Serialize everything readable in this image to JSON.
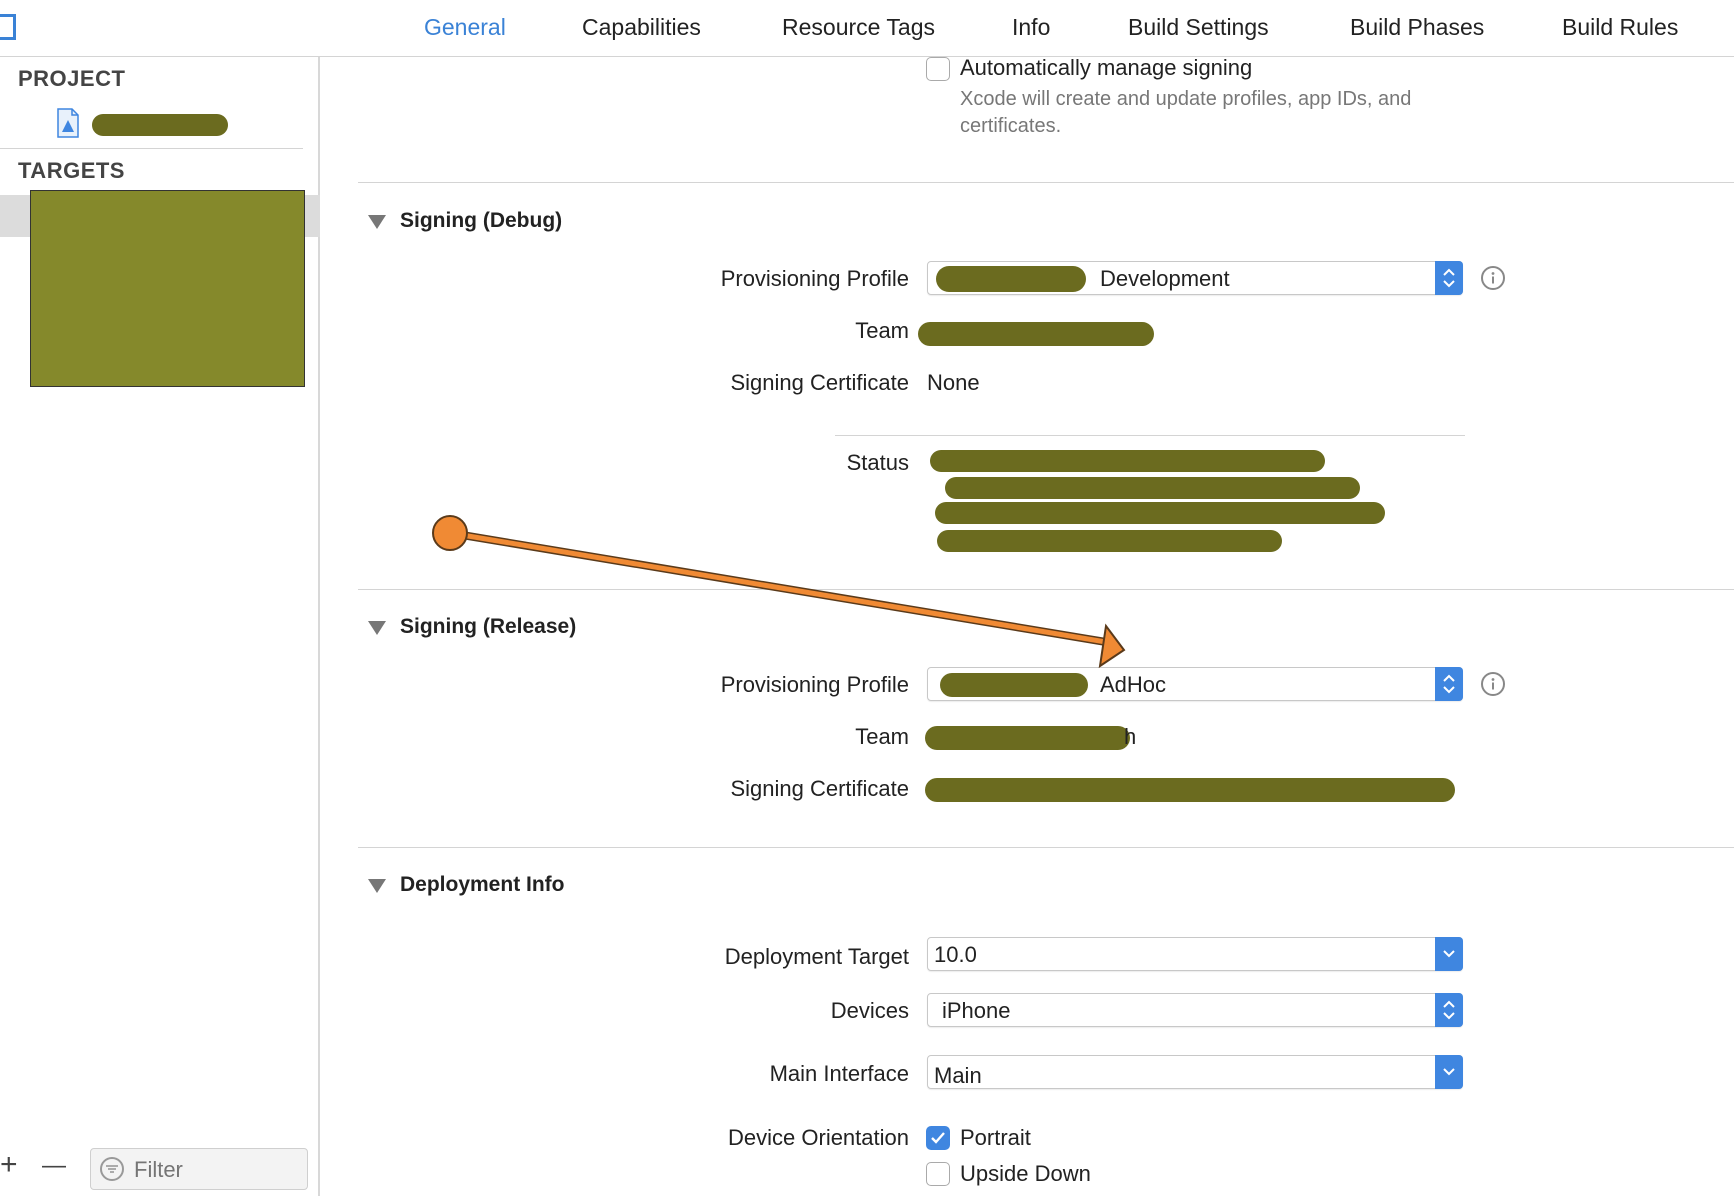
{
  "tabs": [
    {
      "label": "General",
      "active": true
    },
    {
      "label": "Capabilities"
    },
    {
      "label": "Resource Tags"
    },
    {
      "label": "Info"
    },
    {
      "label": "Build Settings"
    },
    {
      "label": "Build Phases"
    },
    {
      "label": "Build Rules"
    }
  ],
  "sidebar": {
    "project_header": "PROJECT",
    "targets_header": "TARGETS",
    "add_symbol": "+",
    "remove_symbol": "—",
    "filter_placeholder": "Filter"
  },
  "signing": {
    "auto_manage_label": "Automatically manage signing",
    "auto_manage_checked": false,
    "auto_manage_help": "Xcode will create and update profiles, app IDs, and certificates."
  },
  "signing_debug": {
    "title": "Signing (Debug)",
    "labels": {
      "provisioning_profile": "Provisioning Profile",
      "team": "Team",
      "signing_certificate": "Signing Certificate",
      "status": "Status"
    },
    "provisioning_profile_value": "Development",
    "signing_certificate_value": "None"
  },
  "signing_release": {
    "title": "Signing (Release)",
    "labels": {
      "provisioning_profile": "Provisioning Profile",
      "team": "Team",
      "signing_certificate": "Signing Certificate"
    },
    "provisioning_profile_value": "AdHoc",
    "team_suffix": "h"
  },
  "deployment": {
    "title": "Deployment Info",
    "labels": {
      "deployment_target": "Deployment Target",
      "devices": "Devices",
      "main_interface": "Main Interface",
      "device_orientation": "Device Orientation"
    },
    "deployment_target_value": "10.0",
    "devices_value": "iPhone",
    "main_interface_value": "Main",
    "orientations": [
      {
        "label": "Portrait",
        "checked": true
      },
      {
        "label": "Upside Down",
        "checked": false
      }
    ]
  },
  "colors": {
    "accent": "#3f86e0",
    "annotation_arrow": "#f08a34",
    "redaction": "#6b6b1f"
  }
}
